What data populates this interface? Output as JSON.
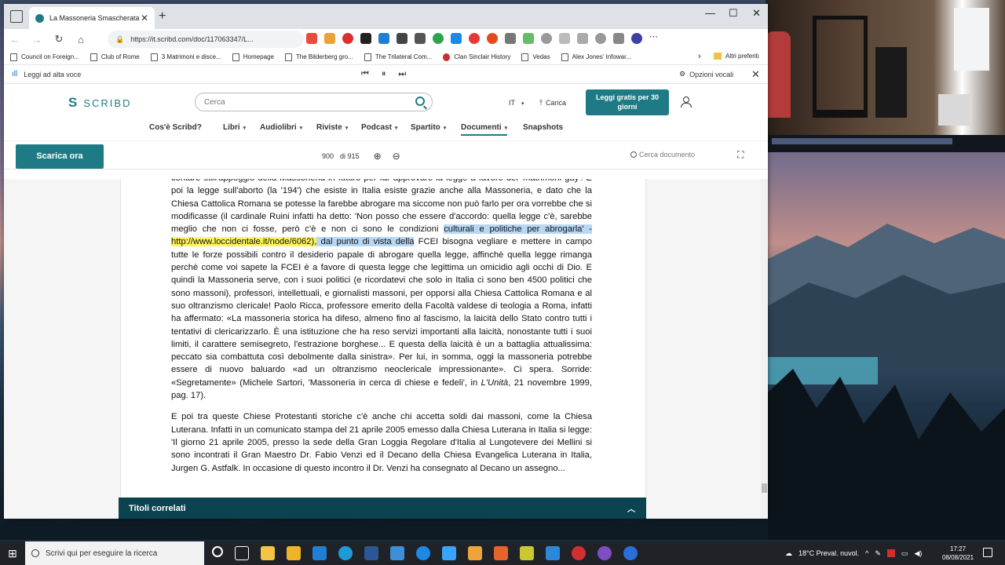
{
  "browser": {
    "tab_title": "La Massoneria Smascherata",
    "url": "https://it.scribd.com/doc/117063347/L...",
    "bookmarks": [
      {
        "label": "Council on Foreign..."
      },
      {
        "label": "Club of Rome"
      },
      {
        "label": "3 Matrimoni e disce..."
      },
      {
        "label": "Homepage"
      },
      {
        "label": "The Bilderberg gro..."
      },
      {
        "label": "The Trilateral Com..."
      },
      {
        "label": "Clan Sinclair History"
      },
      {
        "label": "Vedas"
      },
      {
        "label": "Alex Jones' Infowar..."
      }
    ],
    "other_bookmarks": "Altri preferiti",
    "read_aloud": {
      "label": "Leggi ad alta voce",
      "voice_options": "Opzioni vocali"
    }
  },
  "scribd": {
    "logo": "SCRIBD",
    "search_placeholder": "Cerca",
    "language": "IT",
    "upload": "Carica",
    "cta": "Leggi gratis per 30 giorni",
    "nav": [
      {
        "label": "Cos'è Scribd?",
        "caret": false
      },
      {
        "label": "Libri",
        "caret": true
      },
      {
        "label": "Audiolibri",
        "caret": true
      },
      {
        "label": "Riviste",
        "caret": true
      },
      {
        "label": "Podcast",
        "caret": true
      },
      {
        "label": "Spartito",
        "caret": true
      },
      {
        "label": "Documenti",
        "caret": true,
        "active": true
      },
      {
        "label": "Snapshots",
        "caret": false
      }
    ],
    "download": "Scarica ora",
    "page_current": "900",
    "page_total": "di 915",
    "doc_search_placeholder": "Cerca documento",
    "related_titles": "Titoli correlati"
  },
  "document": {
    "para1_top": "contare sull'appoggio della Massoneria in futuro per far approvare la legge a favore dei 'matrimoni gay'. E poi la legge sull'aborto (la '194') che esiste in Italia esiste grazie anche alla Massoneria, e dato che la Chiesa Cattolica Romana se potesse la farebbe abrogare ma siccome non può farlo per ora vorrebbe che si modificasse (il cardinale Ruini infatti ha detto: 'Non posso che essere d'accordo: quella legge c'è, sarebbe meglio che non ci fosse, però c'è e non ci sono le condizioni",
    "para1_blue1": "culturali e politiche per abrogarla' - ",
    "para1_link": "http://www.loccidentale.it/node/6062),",
    "para1_blue2": " dal punto di vista della",
    "para1_rest": " FCEI bisogna vegliare e mettere in campo tutte le forze possibili contro il desiderio papale di abrogare quella legge, affinchè quella legge rimanga perchè come voi sapete la FCEI è a favore di questa legge che legittima un omicidio agli occhi di Dio. E quindi la Massoneria serve, con i suoi politici (e ricordatevi che solo in Italia ci sono ben 4500 politici che sono massoni), professori, intellettuali, e giornalisti massoni, per opporsi alla Chiesa Cattolica Romana e al suo oltranzismo clericale! Paolo Ricca, professore emerito della Facoltà valdese di teologia a Roma, infatti ha affermato: «La massoneria storica ha difeso, almeno fino al fascismo, la laicità dello Stato contro tutti i tentativi di clericarizzarlo. È una istituzione che ha reso servizi importanti alla laicità, nonostante tutti i suoi limiti, il carattere semisegreto, l'estrazione borghese... E questa della laicità è un a battaglia attualissima: peccato sia combattuta così debolmente dalla sinistra». Per lui, in somma, oggi la massoneria potrebbe essere di nuovo baluardo «ad un oltranzismo neoclericale impressionante». Ci spera. Sorride: «Segretamente» (Michele Sartori, 'Massoneria in cerca di chiese e fedeli', in ",
    "para1_italic": "L'Unità",
    "para1_end": ", 21 novembre 1999, pag. 17).",
    "para2": "E poi tra queste Chiese Protestanti storiche c'è anche chi accetta soldi dai massoni, come la Chiesa Luterana. Infatti in un comunicato stampa del 21 aprile 2005 emesso dalla Chiesa Luterana in Italia si legge: 'Il giorno 21 aprile 2005, presso la sede della Gran Loggia Regolare d'Italia al Lungotevere dei Mellini si sono incontrati il Gran Maestro Dr. Fabio Venzi ed il Decano della Chiesa Evangelica Luterana in Italia, Jurgen G. Astfalk. In occasione di questo incontro il Dr. Venzi ha consegnato al Decano un assegno..."
  },
  "taskbar": {
    "search_placeholder": "Scrivi qui per eseguire la ricerca",
    "weather": "18°C Preval. nuvol.",
    "time": "17:27",
    "date": "08/08/2021"
  },
  "colors": {
    "brand": "#1e7b85",
    "related_bar": "#0b4450",
    "highlight_yellow": "#fff45a",
    "highlight_blue": "#b7d7f5"
  }
}
